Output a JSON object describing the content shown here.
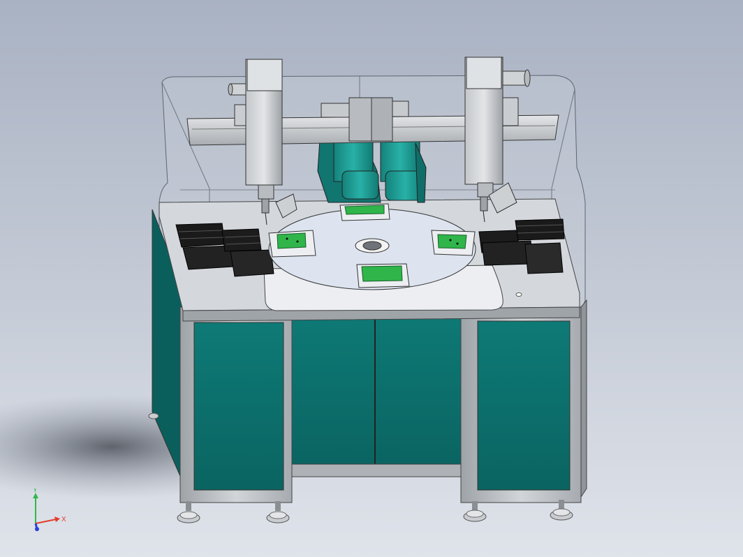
{
  "viewport": {
    "background_top": "#a9b2c3",
    "background_bottom": "#dfe3ea",
    "colors": {
      "cabinet_teal": "#0d7370",
      "frame_gray": "#bfc3c7",
      "table_top": "#d9dce0",
      "disc": "#dde4f0",
      "gantry": "#d3d6d9",
      "cylinder_teal": "#1a9a92",
      "pcb_green": "#2fb54a",
      "tray_black": "#1a1a1a"
    }
  },
  "triad": {
    "x_label": "X",
    "y_label": "Y",
    "x_color": "#e53b2c",
    "y_color": "#2fb84a",
    "z_color": "#2a3fd8"
  }
}
